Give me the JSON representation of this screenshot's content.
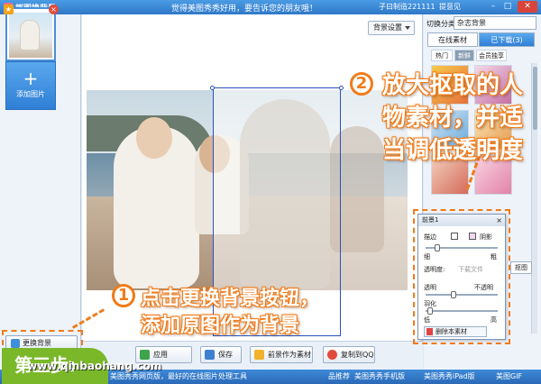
{
  "window": {
    "title": "抠图换背景",
    "banner": "觉得美图秀秀好用，要告诉您的朋友哦！",
    "user": "子曰制造221111",
    "feedback": "提意见"
  },
  "left_panel": {
    "add_label": "添加图片",
    "change_bg_label": "更换背景"
  },
  "canvas": {
    "bg_settings_label": "背景设置"
  },
  "toolbar": {
    "apply_label": "应用",
    "save_label": "保存",
    "fg_material_label": "前景作为素材",
    "copy_qq_label": "复制到QQ"
  },
  "right_panel": {
    "category_label": "切换分类:",
    "category_value": "杂志背景",
    "tabs": [
      "在线素材",
      "已下载(3)"
    ],
    "subtabs": [
      "热门",
      "新鲜",
      "会员独享"
    ],
    "side_button": "抠图"
  },
  "fg_popup": {
    "title": "前景1",
    "stroke_label": "描边",
    "shadow_label": "阴影",
    "thin_label": "细",
    "thick_label": "粗",
    "transparency_label": "透明度:",
    "download_text": "下载文件",
    "transparent_label": "透明",
    "opaque_label": "不透明",
    "feather_label": "羽化",
    "low_label": "低",
    "high_label": "高",
    "delete_label": "删除本素材"
  },
  "annotations": {
    "step1_number": "1",
    "step1_line1": "点击更换背景按钮，",
    "step1_line2": "添加原图作为背景",
    "step2_number": "2",
    "step2_line1": "放大抠取的人",
    "step2_line2": "物素材，并适",
    "step2_line3": "当调低透明度",
    "step_badge": "第三步:",
    "watermark": "www.qinbaohang.com"
  },
  "status_bar": {
    "left_text": "美图秀秀网页版，最好的在线图片处理工具",
    "recommend": "品推荐",
    "link1": "美图秀秀手机版",
    "link2": "美图秀秀iPad版",
    "link3": "美图GIF"
  },
  "colors": {
    "accent": "#f07b1a",
    "title_bar": "#2f78c8",
    "step_badge": "#7ab82a"
  }
}
